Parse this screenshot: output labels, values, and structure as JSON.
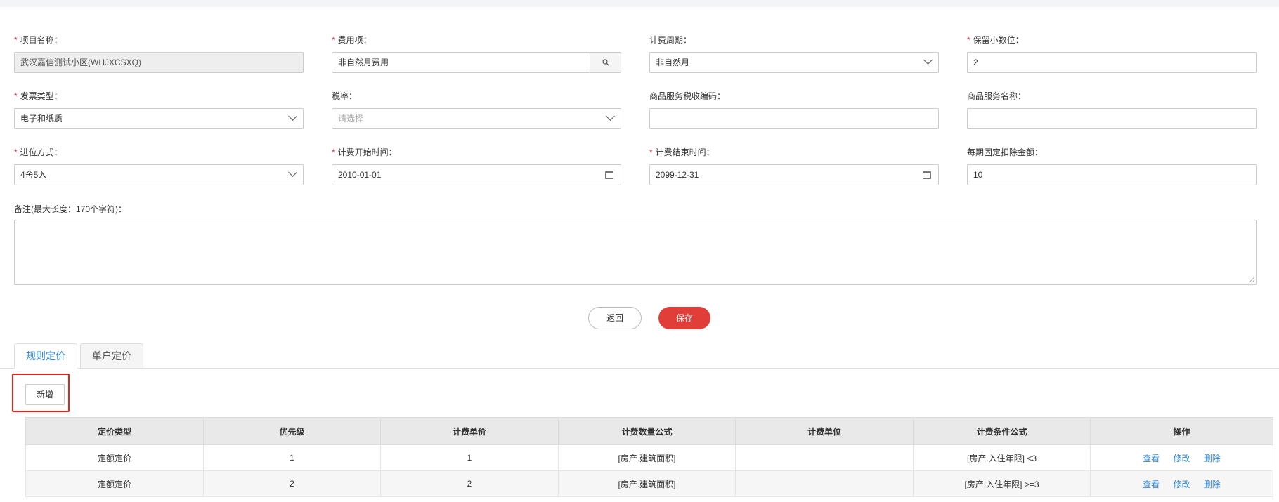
{
  "form": {
    "project_name": {
      "label": "项目名称：",
      "required": true,
      "value": "武汉嘉信测试小区(WHJXCSXQ)"
    },
    "fee_item": {
      "label": "费用项：",
      "required": true,
      "value": "非自然月费用"
    },
    "billing_cycle": {
      "label": "计费周期：",
      "required": false,
      "value": "非自然月"
    },
    "decimal_places": {
      "label": "保留小数位：",
      "required": true,
      "value": "2"
    },
    "invoice_type": {
      "label": "发票类型：",
      "required": true,
      "value": "电子和纸质"
    },
    "tax_rate": {
      "label": "税率：",
      "required": false,
      "placeholder": "请选择"
    },
    "tax_code": {
      "label": "商品服务税收编码：",
      "required": false,
      "value": ""
    },
    "service_name": {
      "label": "商品服务名称：",
      "required": false,
      "value": ""
    },
    "rounding": {
      "label": "进位方式：",
      "required": true,
      "value": "4舍5入"
    },
    "start_time": {
      "label": "计费开始时间：",
      "required": true,
      "value": "2010-01-01"
    },
    "end_time": {
      "label": "计费结束时间：",
      "required": true,
      "value": "2099-12-31"
    },
    "fixed_deduction": {
      "label": "每期固定扣除金额：",
      "required": false,
      "value": "10"
    },
    "notes": {
      "label": "备注(最大长度：170个字符)：",
      "value": ""
    }
  },
  "actions": {
    "back": "返回",
    "save": "保存"
  },
  "tabs": [
    {
      "label": "规则定价",
      "active": true
    },
    {
      "label": "单户定价",
      "active": false
    }
  ],
  "toolbar": {
    "add": "新增"
  },
  "table": {
    "headers": [
      "定价类型",
      "优先级",
      "计费单价",
      "计费数量公式",
      "计费单位",
      "计费条件公式",
      "操作"
    ],
    "rows": [
      {
        "type": "定额定价",
        "priority": "1",
        "unit_price": "1",
        "qty_formula": "[房产.建筑面积]",
        "unit": "",
        "condition": "[房产.入住年限] <3"
      },
      {
        "type": "定额定价",
        "priority": "2",
        "unit_price": "2",
        "qty_formula": "[房产.建筑面积]",
        "unit": "",
        "condition": "[房产.入住年限] >=3"
      }
    ],
    "ops": [
      "查看",
      "修改",
      "删除"
    ]
  },
  "colors": {
    "required": "#e4393c",
    "primary": "#e13e3a",
    "link": "#2f86d6",
    "highlight": "#e1251b"
  },
  "icons": [
    "search-icon",
    "chevron-down-icon",
    "calendar-icon",
    "resize-grip-icon"
  ]
}
